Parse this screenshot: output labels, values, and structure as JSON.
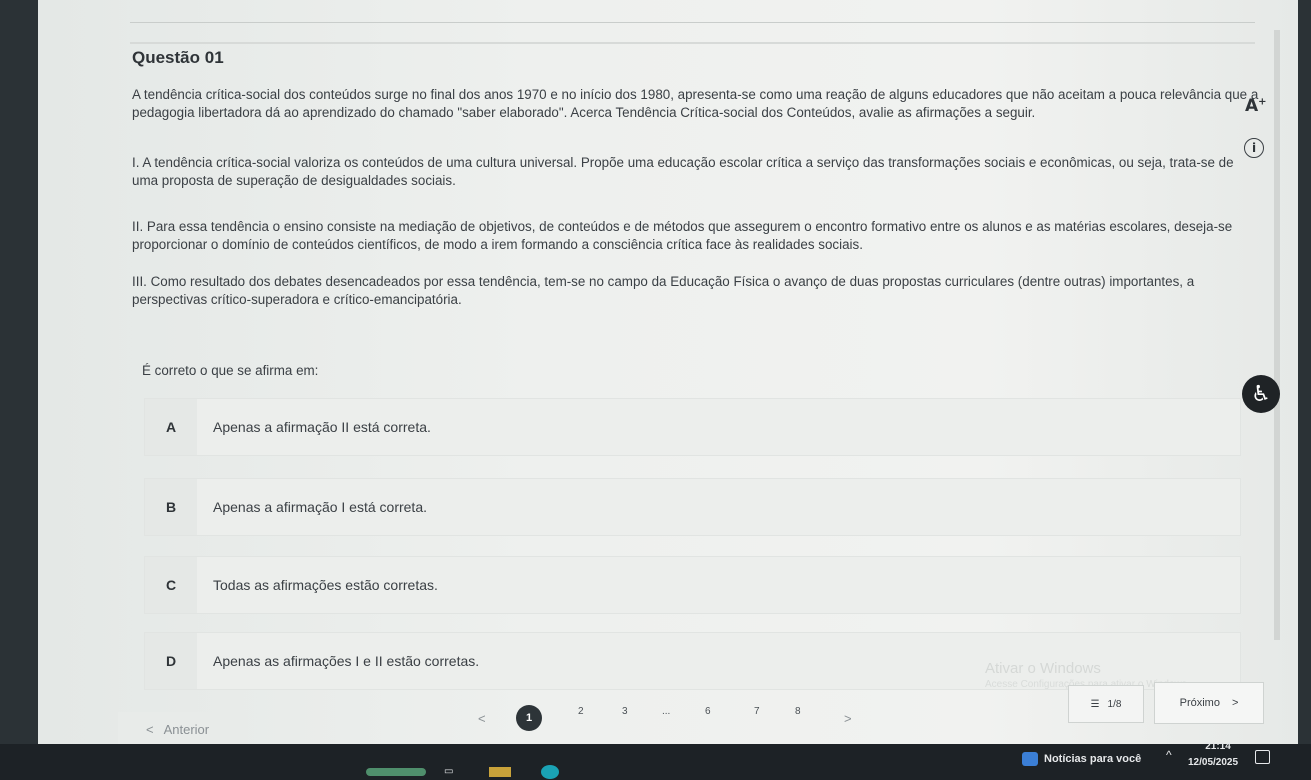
{
  "question": {
    "title": "Questão 01",
    "intro": "A tendência crítica-social dos conteúdos surge no final dos anos 1970 e no início dos 1980, apresenta-se como uma reação de alguns educadores que não aceitam a pouca relevância que a pedagogia libertadora dá ao aprendizado do chamado \"saber elaborado\". Acerca Tendência Crítica-social dos Conteúdos, avalie as afirmações a seguir.",
    "statements": [
      "I. A tendência crítica-social valoriza os conteúdos de uma cultura universal. Propõe uma educação escolar crítica a serviço das transformações sociais e econômicas, ou seja, trata-se de uma proposta de superação de desigualdades sociais.",
      "II. Para essa tendência o ensino consiste na mediação de objetivos, de conteúdos e de métodos que assegurem o encontro formativo entre os alunos e as matérias escolares, deseja-se proporcionar o domínio de conteúdos científicos, de modo a irem formando a consciência crítica face às realidades sociais.",
      "III. Como resultado dos debates desencadeados por essa tendência, tem-se no campo da Educação Física o avanço de duas propostas curriculares (dentre outras) importantes, a perspectivas crítico-superadora e crítico-emancipatória."
    ],
    "prompt": "É correto o que se afirma em:"
  },
  "options": [
    {
      "letter": "A",
      "text": "Apenas a afirmação II está correta."
    },
    {
      "letter": "B",
      "text": "Apenas a afirmação I está correta."
    },
    {
      "letter": "C",
      "text": "Todas as afirmações estão corretas."
    },
    {
      "letter": "D",
      "text": "Apenas as afirmações I e II estão corretas."
    }
  ],
  "side_tools": {
    "font_size": "A",
    "font_size_sup": "+",
    "info": "i",
    "accessibility": "♿"
  },
  "watermark": {
    "line1": "Ativar o Windows",
    "line2": "Acesse Configurações para ativar o Windows."
  },
  "navigation": {
    "prev_chevron": "<",
    "prev_label": "Anterior",
    "pager_prev": "<",
    "pages": [
      "1",
      "2",
      "3",
      "...",
      "6",
      "7",
      "8"
    ],
    "current_page": "1",
    "pager_next": ">",
    "progress": "1/8",
    "progress_icon": "☰",
    "next_label": "Próximo",
    "next_chevron": ">"
  },
  "taskbar": {
    "news": "Notícias para você",
    "caret": "^",
    "time": "21:14",
    "date": "12/05/2025"
  }
}
